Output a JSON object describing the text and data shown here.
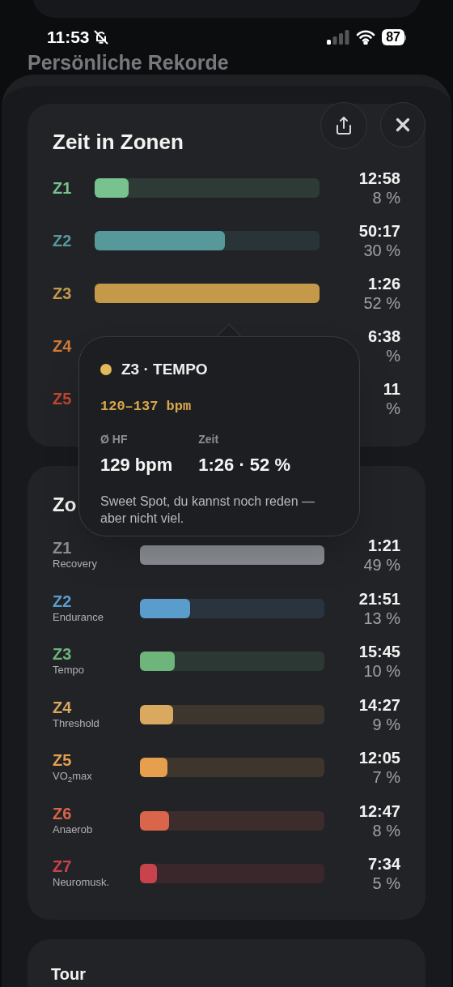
{
  "status_bar": {
    "time": "11:53",
    "battery": "87"
  },
  "background_title": "Persönliche Rekorde",
  "sheet": {
    "zone_card": {
      "title": "Zeit in Zonen",
      "rows": [
        {
          "zone": "Z1",
          "color": "#77c28e",
          "level": 0.15,
          "time": "12:58",
          "percent": "8 %"
        },
        {
          "zone": "Z2",
          "color": "#57999a",
          "level": 0.58,
          "time": "50:17",
          "percent": "30 %"
        },
        {
          "zone": "Z3",
          "color": "#c4994a",
          "level": 1.0,
          "time": "1:26",
          "percent": "52 %"
        },
        {
          "zone": "Z4",
          "color": "#d27a38",
          "time": "6:38",
          "percent": "%"
        },
        {
          "zone": "Z5",
          "color": "#c0472f",
          "time": "11",
          "percent": "%"
        }
      ]
    },
    "tooltip": {
      "color": "#e2b85a",
      "title": "Z3 · TEMPO",
      "range": "120–137 bpm",
      "stats": [
        {
          "label": "Ø HF",
          "value": "129 bpm"
        },
        {
          "label": "Zeit",
          "value": "1:26 · 52 %"
        }
      ],
      "note": "Sweet Spot, du kannst noch reden — aber nicht viel."
    },
    "power_card": {
      "title": "Zo",
      "rows": [
        {
          "zone": "Z1",
          "name": "Recovery",
          "color": "#8a8d93",
          "level": 1.0,
          "time": "1:21",
          "percent": "49 %"
        },
        {
          "zone": "Z2",
          "name": "Endurance",
          "color": "#5a9ccc",
          "level": 0.27,
          "time": "21:51",
          "percent": "13 %"
        },
        {
          "zone": "Z3",
          "name": "Tempo",
          "color": "#6db57a",
          "level": 0.19,
          "time": "15:45",
          "percent": "10 %"
        },
        {
          "zone": "Z4",
          "name": "Threshold",
          "color": "#d8a95e",
          "level": 0.18,
          "time": "14:27",
          "percent": "9 %"
        },
        {
          "zone": "Z5",
          "name": "VO$_{2}$max",
          "color": "#e6a04d",
          "level": 0.15,
          "time": "12:05",
          "percent": "7 %"
        },
        {
          "zone": "Z6",
          "name": "Anaerob",
          "color": "#d9654a",
          "level": 0.16,
          "time": "12:47",
          "percent": "8 %"
        },
        {
          "zone": "Z7",
          "name": "Neuromusk.",
          "color": "#c9434c",
          "level": 0.09,
          "time": "7:34",
          "percent": "5 %"
        }
      ]
    },
    "tour_card": {
      "title": "Tour"
    }
  }
}
